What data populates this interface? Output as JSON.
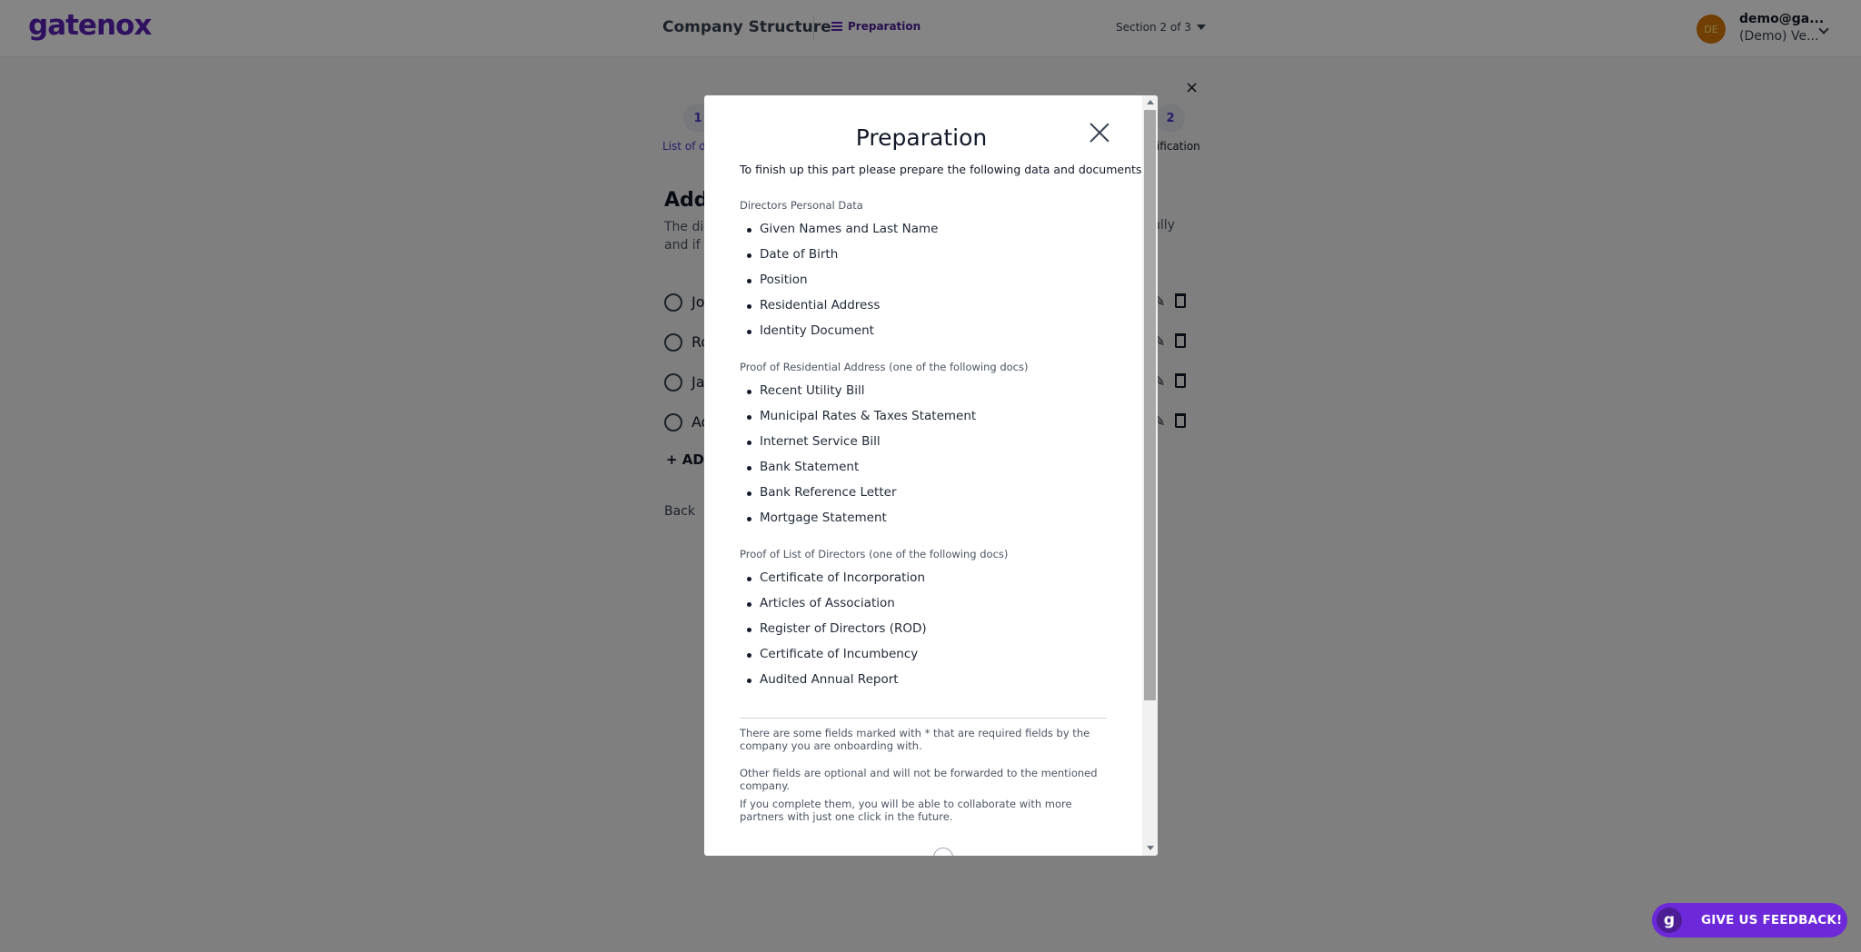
{
  "header": {
    "logo": "gatenox",
    "title": "Company Structure",
    "preparation_label": "Preparation",
    "section": "Section 2 of 3",
    "avatar_initials": "DE",
    "user_email": "demo@ga...",
    "user_org": "(Demo) Ve..."
  },
  "page": {
    "close": "×",
    "step1_number": "1",
    "step1_label": "List of di",
    "step2_number": "2",
    "step2_label": "rification",
    "add_title": "Add",
    "desc_line1": "The dir",
    "desc_line2": "and if s",
    "desc_right": "ully",
    "directors": [
      "Jo",
      "Ro",
      "Ja",
      "Ad"
    ],
    "add_button": "+ AD",
    "back_button": "Back"
  },
  "modal": {
    "title": "Preparation",
    "intro": "To finish up this part please prepare the following data and documents",
    "section1_title": "Directors Personal Data",
    "section1_items": [
      "Given Names and Last Name",
      "Date of Birth",
      "Position",
      "Residential Address",
      "Identity Document"
    ],
    "section2_title": "Proof of Residential Address (one of the following docs)",
    "section2_items": [
      "Recent Utility Bill",
      "Municipal Rates & Taxes Statement",
      "Internet Service Bill",
      "Bank Statement",
      "Bank Reference Letter",
      "Mortgage Statement"
    ],
    "section3_title": "Proof of List of Directors (one of the following docs)",
    "section3_items": [
      "Certificate of Incorporation",
      "Articles of Association",
      "Register of Directors (ROD)",
      "Certificate of Incumbency",
      "Audited Annual Report"
    ],
    "note1": "There are some fields marked with * that are required fields by the company you are onboarding with.",
    "note2a": "Other fields are optional and will not be forwarded to the mentioned company.",
    "note2b": "If you complete them, you will be able to collaborate with more partners with just one click in the future."
  },
  "feedback": {
    "logo": "g",
    "label": "GIVE US FEEDBACK!"
  },
  "colors": {
    "brand": "#5b21b6",
    "feedback": "#6d28d9",
    "avatar": "#d97706"
  }
}
